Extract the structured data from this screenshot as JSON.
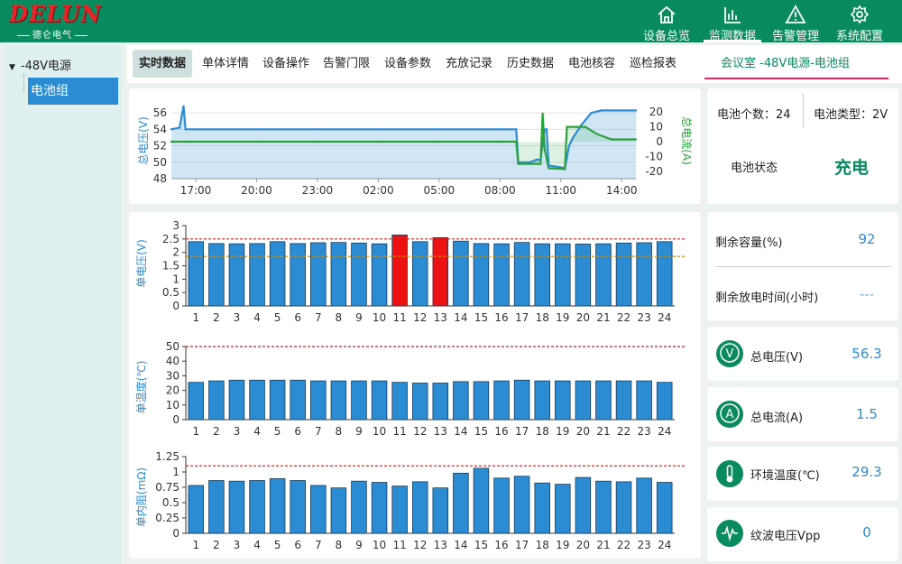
{
  "brand": {
    "logo_text": "DELUN",
    "logo_sub": "德仑电气"
  },
  "nav": [
    {
      "label": "设备总览",
      "icon": "home-icon"
    },
    {
      "label": "监测数据",
      "icon": "bar-chart-icon"
    },
    {
      "label": "告警管理",
      "icon": "warning-icon"
    },
    {
      "label": "系统配置",
      "icon": "gear-icon"
    }
  ],
  "active_nav": 1,
  "sidebar": {
    "root": "-48V电源",
    "child": "电池组"
  },
  "tabs": [
    "实时数据",
    "单体详情",
    "设备操作",
    "告警门限",
    "设备参数",
    "充放记录",
    "历史数据",
    "电池核容",
    "巡检报表"
  ],
  "active_tab": 0,
  "breadcrumb": "会议室 -48V电源-电池组",
  "summary": {
    "count_label": "电池个数：24",
    "type_label": "电池类型：2V",
    "status_label": "电池状态",
    "status_value": "充电"
  },
  "metrics": [
    {
      "label": "剩余容量(%)",
      "value": "92"
    },
    {
      "label": "剩余放电时间(小时)",
      "value": "---"
    }
  ],
  "stats": [
    {
      "icon": "voltage-icon",
      "glyph": "V",
      "label": "总电压(V)",
      "value": "56.3"
    },
    {
      "icon": "current-icon",
      "glyph": "A",
      "label": "总电流(A)",
      "value": "1.5"
    },
    {
      "icon": "thermometer-icon",
      "glyph": "",
      "label": "环境温度(℃)",
      "value": "29.3"
    },
    {
      "icon": "ripple-icon",
      "glyph": "",
      "label": "纹波电压Vpp",
      "value": "0"
    }
  ],
  "colors": {
    "brand": "#0a8a5f",
    "bar": "#2c8cd3",
    "alarm_bar": "#ee1111",
    "current": "#2aa23a",
    "threshold": "#cc2222",
    "threshold_low": "#d48a00"
  },
  "chart_data": [
    {
      "type": "line",
      "xlabel": "",
      "ylabel": "总电压(V)",
      "y2label": "总电流(A)",
      "x_ticks": [
        "17:00",
        "20:00",
        "23:00",
        "02:00",
        "05:00",
        "08:00",
        "11:00",
        "14:00"
      ],
      "ylim": [
        48,
        57
      ],
      "y_ticks": [
        48,
        50,
        52,
        54,
        56
      ],
      "y2lim": [
        -25,
        25
      ],
      "y2_ticks": [
        -20,
        -10,
        0,
        10,
        20
      ],
      "x_range": [
        15.8,
        38.7
      ],
      "series": [
        {
          "axis": "left",
          "points": [
            [
              15.8,
              54.0
            ],
            [
              16.2,
              54.2
            ],
            [
              16.4,
              56.8
            ],
            [
              16.5,
              54.0
            ],
            [
              20,
              54.0
            ],
            [
              23,
              54.0
            ],
            [
              26,
              54.0
            ],
            [
              29,
              54.0
            ],
            [
              32,
              54.0
            ],
            [
              32.8,
              54.0
            ],
            [
              32.9,
              50.0
            ],
            [
              33.5,
              50.0
            ],
            [
              33.8,
              50.3
            ],
            [
              34.0,
              50.3
            ],
            [
              34.2,
              54.0
            ],
            [
              34.3,
              54.0
            ],
            [
              34.4,
              49.6
            ],
            [
              35.2,
              49.3
            ],
            [
              35.4,
              52.0
            ],
            [
              35.6,
              53.0
            ],
            [
              36.0,
              54.5
            ],
            [
              36.5,
              56.0
            ],
            [
              37.0,
              56.3
            ],
            [
              38.7,
              56.3
            ]
          ]
        },
        {
          "axis": "right",
          "points": [
            [
              15.8,
              0.0
            ],
            [
              16.5,
              0.0
            ],
            [
              20,
              0.0
            ],
            [
              23,
              0.0
            ],
            [
              26,
              0.0
            ],
            [
              29,
              0.0
            ],
            [
              32,
              0.0
            ],
            [
              32.8,
              0.0
            ],
            [
              32.9,
              -15.0
            ],
            [
              33.9,
              -15.0
            ],
            [
              34.0,
              -15.0
            ],
            [
              34.1,
              19.0
            ],
            [
              34.2,
              -5.0
            ],
            [
              34.4,
              -18.0
            ],
            [
              35.2,
              -18.5
            ],
            [
              35.3,
              10.0
            ],
            [
              36.2,
              10.0
            ],
            [
              36.8,
              5.0
            ],
            [
              37.5,
              1.5
            ],
            [
              38.7,
              1.5
            ]
          ]
        }
      ]
    },
    {
      "type": "bar",
      "ylabel": "单电压(V)",
      "categories": [
        "1",
        "2",
        "3",
        "4",
        "5",
        "6",
        "7",
        "8",
        "9",
        "10",
        "11",
        "12",
        "13",
        "14",
        "15",
        "16",
        "17",
        "18",
        "19",
        "20",
        "21",
        "22",
        "23",
        "24"
      ],
      "values": [
        2.4,
        2.33,
        2.32,
        2.33,
        2.4,
        2.33,
        2.36,
        2.37,
        2.35,
        2.32,
        2.65,
        2.4,
        2.55,
        2.42,
        2.33,
        2.32,
        2.37,
        2.32,
        2.32,
        2.31,
        2.32,
        2.35,
        2.36,
        2.4
      ],
      "alarm_indices": [
        10,
        12
      ],
      "ylim": [
        0,
        3
      ],
      "y_ticks": [
        0,
        0.5,
        1,
        1.5,
        2,
        2.5,
        3
      ],
      "thresholds": [
        2.5,
        1.85
      ]
    },
    {
      "type": "bar",
      "ylabel": "单温度(℃)",
      "categories": [
        "1",
        "2",
        "3",
        "4",
        "5",
        "6",
        "7",
        "8",
        "9",
        "10",
        "11",
        "12",
        "13",
        "14",
        "15",
        "16",
        "17",
        "18",
        "19",
        "20",
        "21",
        "22",
        "23",
        "24"
      ],
      "values": [
        25.5,
        26.5,
        27,
        27,
        27,
        27,
        26.5,
        26.5,
        26.5,
        26.5,
        25.5,
        25,
        25,
        26,
        26,
        26.5,
        27,
        26.5,
        26.5,
        26.5,
        26.5,
        26.5,
        26.5,
        25.5
      ],
      "ylim": [
        0,
        50
      ],
      "y_ticks": [
        0,
        10,
        20,
        30,
        40,
        50
      ],
      "thresholds": [
        50
      ]
    },
    {
      "type": "bar",
      "ylabel": "单内阻(mΩ)",
      "categories": [
        "1",
        "2",
        "3",
        "4",
        "5",
        "6",
        "7",
        "8",
        "9",
        "10",
        "11",
        "12",
        "13",
        "14",
        "15",
        "16",
        "17",
        "18",
        "19",
        "20",
        "21",
        "22",
        "23",
        "24"
      ],
      "values": [
        0.78,
        0.86,
        0.85,
        0.86,
        0.89,
        0.86,
        0.78,
        0.74,
        0.85,
        0.83,
        0.77,
        0.84,
        0.74,
        0.98,
        1.06,
        0.9,
        0.93,
        0.82,
        0.8,
        0.91,
        0.85,
        0.84,
        0.9,
        0.83
      ],
      "ylim": [
        0,
        1.25
      ],
      "y_ticks": [
        0,
        0.25,
        0.5,
        0.75,
        1,
        1.25
      ],
      "thresholds": [
        1.1
      ]
    }
  ]
}
